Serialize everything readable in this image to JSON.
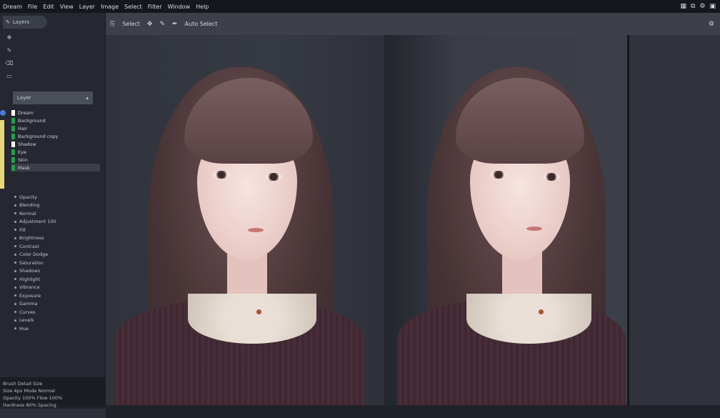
{
  "menubar": {
    "items": [
      "Dream",
      "File",
      "Edit",
      "View",
      "Layer",
      "Image",
      "Select",
      "Filter",
      "Window",
      "Help"
    ],
    "right_icons": [
      "grid-icon",
      "window-icon",
      "settings-icon",
      "layout-icon"
    ]
  },
  "sidebar": {
    "tab_label": "Layers",
    "panel_header": "Layer",
    "layers": [
      {
        "label": "Dream",
        "color": "#ffffff"
      },
      {
        "label": "Background",
        "color": "#2a9a4a"
      },
      {
        "label": "Hair",
        "color": "#2a9a4a"
      },
      {
        "label": "Background copy",
        "color": "#2a9a4a"
      },
      {
        "label": "Shadow",
        "color": "#ffffff"
      },
      {
        "label": "Eye",
        "color": "#2a9a4a"
      },
      {
        "label": "Skin",
        "color": "#2a9a4a"
      },
      {
        "label": "Mask",
        "color": "#2a9a4a"
      }
    ],
    "props": [
      "Opacity",
      "Blending",
      "Normal",
      "Adjustment 100",
      "Fill",
      "Brightness",
      "Contrast",
      "Color Dodge",
      "Saturation",
      "Shadows",
      "Highlight",
      "Vibrance",
      "Exposure",
      "Gamma",
      "Curves",
      "Levels",
      "Hue"
    ],
    "bottom_info": [
      "Brush Detail Size",
      "Size 4px Mode Normal",
      "Opacity 100% Flow 100%",
      "Hardness 80% Spacing"
    ]
  },
  "toolbar": {
    "items": [
      "Select",
      "Move",
      "Brush",
      "Auto Select"
    ],
    "right_icon": "settings-icon"
  },
  "colors": {
    "menubar_bg": "#15171c",
    "sidebar_bg": "#252830",
    "toolbar_bg": "#3d4049",
    "canvas_bg": "#2b2e36",
    "accent_yellow": "#e8d77a",
    "accent_blue": "#4a7ae0",
    "accent_green": "#2a9a4a"
  }
}
